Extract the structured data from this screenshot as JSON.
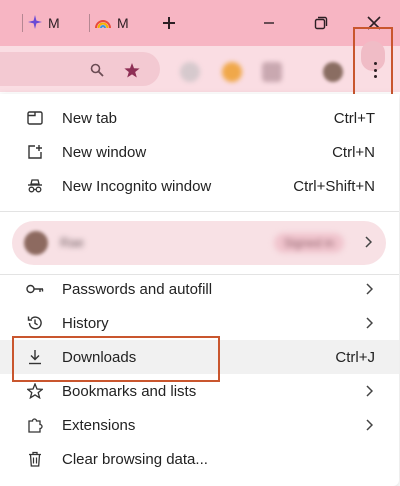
{
  "tabs": [
    {
      "label": "M",
      "icon": "sparkle-icon"
    },
    {
      "label": "M",
      "icon": "rainbow-icon"
    }
  ],
  "profile": {
    "name": "Rae",
    "status": "Signed in"
  },
  "menu": {
    "new_tab": {
      "label": "New tab",
      "shortcut": "Ctrl+T"
    },
    "new_window": {
      "label": "New window",
      "shortcut": "Ctrl+N"
    },
    "new_incognito": {
      "label": "New Incognito window",
      "shortcut": "Ctrl+Shift+N"
    },
    "passwords": {
      "label": "Passwords and autofill"
    },
    "history": {
      "label": "History"
    },
    "downloads": {
      "label": "Downloads",
      "shortcut": "Ctrl+J"
    },
    "bookmarks": {
      "label": "Bookmarks and lists"
    },
    "extensions": {
      "label": "Extensions"
    },
    "clear_data": {
      "label": "Clear browsing data..."
    }
  },
  "colors": {
    "titlebar": "#f7b5c3",
    "toolbar": "#fadde3",
    "highlight_box": "#c9562e"
  }
}
